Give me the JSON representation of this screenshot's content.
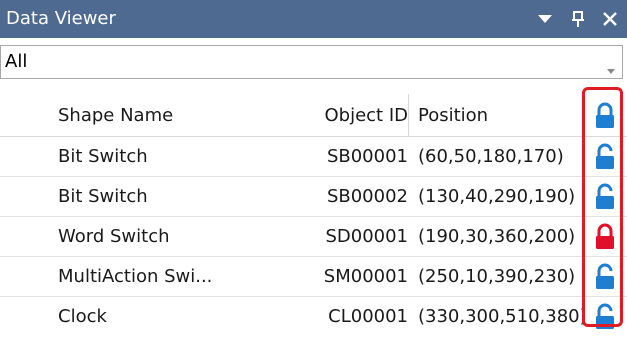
{
  "window": {
    "title": "Data Viewer"
  },
  "filter": {
    "value": "All"
  },
  "columns": {
    "shape_name": "Shape Name",
    "object_id": "Object ID",
    "position": "Position"
  },
  "rows": [
    {
      "name": "Bit Switch",
      "id": "SB00001",
      "position": "(60,50,180,170)",
      "locked": false
    },
    {
      "name": "Bit Switch",
      "id": "SB00002",
      "position": "(130,40,290,190)",
      "locked": false
    },
    {
      "name": "Word Switch",
      "id": "SD00001",
      "position": "(190,30,360,200)",
      "locked": true
    },
    {
      "name": "MultiAction Swi...",
      "id": "SM00001",
      "position": "(250,10,390,230)",
      "locked": false
    },
    {
      "name": "Clock",
      "id": "CL00001",
      "position": "(330,300,510,380)",
      "locked": false
    }
  ],
  "colors": {
    "titlebar": "#4f6a91",
    "unlocked": "#1e7fd0",
    "locked": "#e0102a",
    "highlight": "#e11b22"
  },
  "icons": {
    "dropdown": "triangle-down-icon",
    "pin": "pin-icon",
    "close": "close-icon",
    "lock_header": "lock-icon",
    "unlocked": "unlocked-icon",
    "locked": "locked-icon"
  }
}
